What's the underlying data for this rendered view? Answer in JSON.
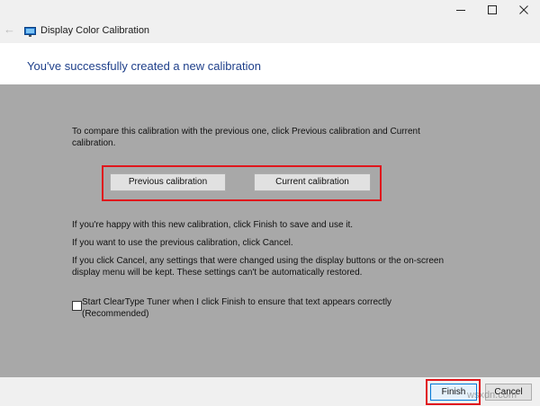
{
  "window": {
    "title": "Display Color Calibration",
    "icons": {
      "back": "back-arrow-icon",
      "app": "display-monitor-icon",
      "minimize": "minimize-icon",
      "maximize": "maximize-icon",
      "close": "close-icon"
    }
  },
  "header": {
    "title": "You've successfully created a new calibration"
  },
  "main": {
    "compare_text": "To compare this calibration with the previous one, click Previous calibration and Current calibration.",
    "buttons": {
      "previous": "Previous calibration",
      "current": "Current calibration"
    },
    "happy_text": "If you're happy with this new calibration, click Finish to save and use it.",
    "previous_text": "If you want to use the previous calibration, click Cancel.",
    "cancel_text": "If you click Cancel, any settings that were changed using the display buttons or the on-screen display menu will be kept. These settings can't be automatically restored.",
    "cleartype": {
      "label": "Start ClearType Tuner when I click Finish to ensure that text appears correctly (Recommended)",
      "checked": false
    }
  },
  "footer": {
    "finish_label": "Finish",
    "cancel_label": "Cancel"
  },
  "watermark": "wsxdn.com",
  "colors": {
    "highlight": "#e0161c",
    "header_text": "#1e3f8a",
    "main_background": "#a8a8a8"
  }
}
